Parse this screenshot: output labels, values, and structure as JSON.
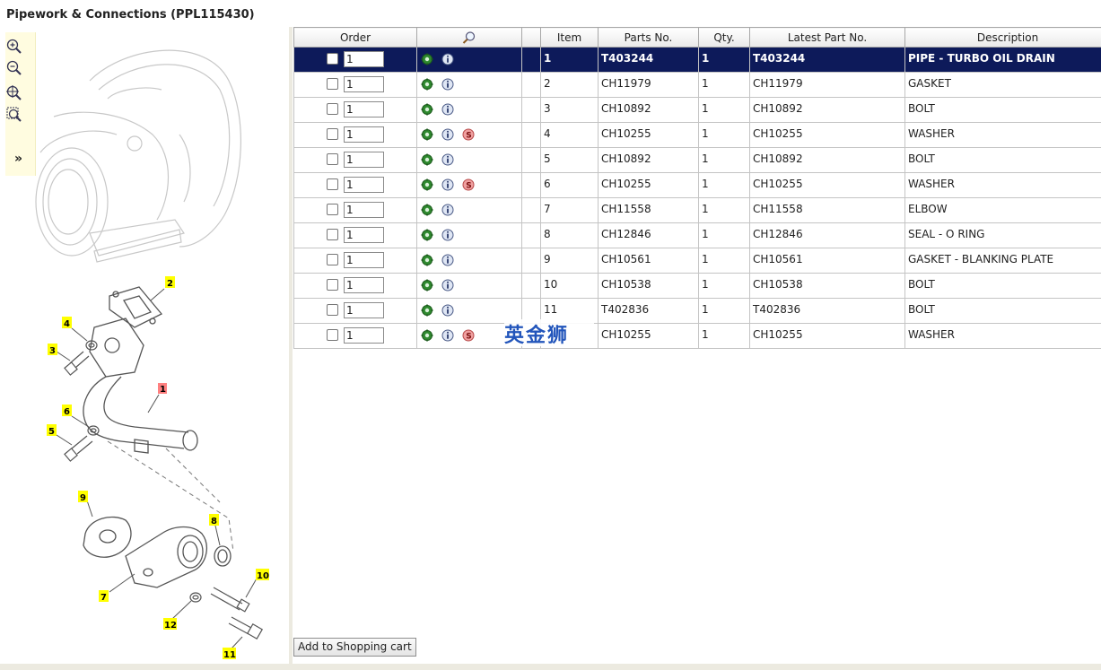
{
  "page": {
    "title": "Pipework & Connections (PPL115430)"
  },
  "zoom": {
    "zoom_in": "zoom-in-icon",
    "zoom_out": "zoom-out-icon",
    "zoom_fit": "zoom-fit-icon",
    "zoom_area": "zoom-area-icon",
    "expand_label": "»"
  },
  "diagram": {
    "callouts": [
      "1",
      "2",
      "3",
      "4",
      "5",
      "6",
      "7",
      "8",
      "9",
      "10",
      "11",
      "12"
    ],
    "highlight_callout": "1"
  },
  "table": {
    "headers": {
      "order": "Order",
      "search_icon": "magnifier-icon",
      "item": "Item",
      "parts_no": "Parts No.",
      "qty": "Qty.",
      "latest": "Latest Part No.",
      "description": "Description"
    },
    "rows": [
      {
        "order_qty": "1",
        "item": "1",
        "part": "T403244",
        "qty": "1",
        "latest": "T403244",
        "desc": "PIPE - TURBO OIL DRAIN",
        "has_s": false,
        "selected": true
      },
      {
        "order_qty": "1",
        "item": "2",
        "part": "CH11979",
        "qty": "1",
        "latest": "CH11979",
        "desc": "GASKET",
        "has_s": false,
        "selected": false
      },
      {
        "order_qty": "1",
        "item": "3",
        "part": "CH10892",
        "qty": "1",
        "latest": "CH10892",
        "desc": "BOLT",
        "has_s": false,
        "selected": false
      },
      {
        "order_qty": "1",
        "item": "4",
        "part": "CH10255",
        "qty": "1",
        "latest": "CH10255",
        "desc": "WASHER",
        "has_s": true,
        "selected": false
      },
      {
        "order_qty": "1",
        "item": "5",
        "part": "CH10892",
        "qty": "1",
        "latest": "CH10892",
        "desc": "BOLT",
        "has_s": false,
        "selected": false
      },
      {
        "order_qty": "1",
        "item": "6",
        "part": "CH10255",
        "qty": "1",
        "latest": "CH10255",
        "desc": "WASHER",
        "has_s": true,
        "selected": false
      },
      {
        "order_qty": "1",
        "item": "7",
        "part": "CH11558",
        "qty": "1",
        "latest": "CH11558",
        "desc": "ELBOW",
        "has_s": false,
        "selected": false
      },
      {
        "order_qty": "1",
        "item": "8",
        "part": "CH12846",
        "qty": "1",
        "latest": "CH12846",
        "desc": "SEAL - O RING",
        "has_s": false,
        "selected": false
      },
      {
        "order_qty": "1",
        "item": "9",
        "part": "CH10561",
        "qty": "1",
        "latest": "CH10561",
        "desc": "GASKET - BLANKING PLATE",
        "has_s": false,
        "selected": false
      },
      {
        "order_qty": "1",
        "item": "10",
        "part": "CH10538",
        "qty": "1",
        "latest": "CH10538",
        "desc": "BOLT",
        "has_s": false,
        "selected": false
      },
      {
        "order_qty": "1",
        "item": "11",
        "part": "T402836",
        "qty": "1",
        "latest": "T402836",
        "desc": "BOLT",
        "has_s": false,
        "selected": false
      },
      {
        "order_qty": "1",
        "item": "",
        "part": "CH10255",
        "qty": "1",
        "latest": "CH10255",
        "desc": "WASHER",
        "has_s": true,
        "selected": false
      }
    ]
  },
  "watermark": "英金狮",
  "actions": {
    "add_to_cart": "Add to Shopping cart"
  },
  "colors": {
    "selected_row": "#0d1a5a",
    "callout_bg": "#ffff00",
    "callout_highlight": "#ff8080",
    "watermark": "#2255bb"
  }
}
